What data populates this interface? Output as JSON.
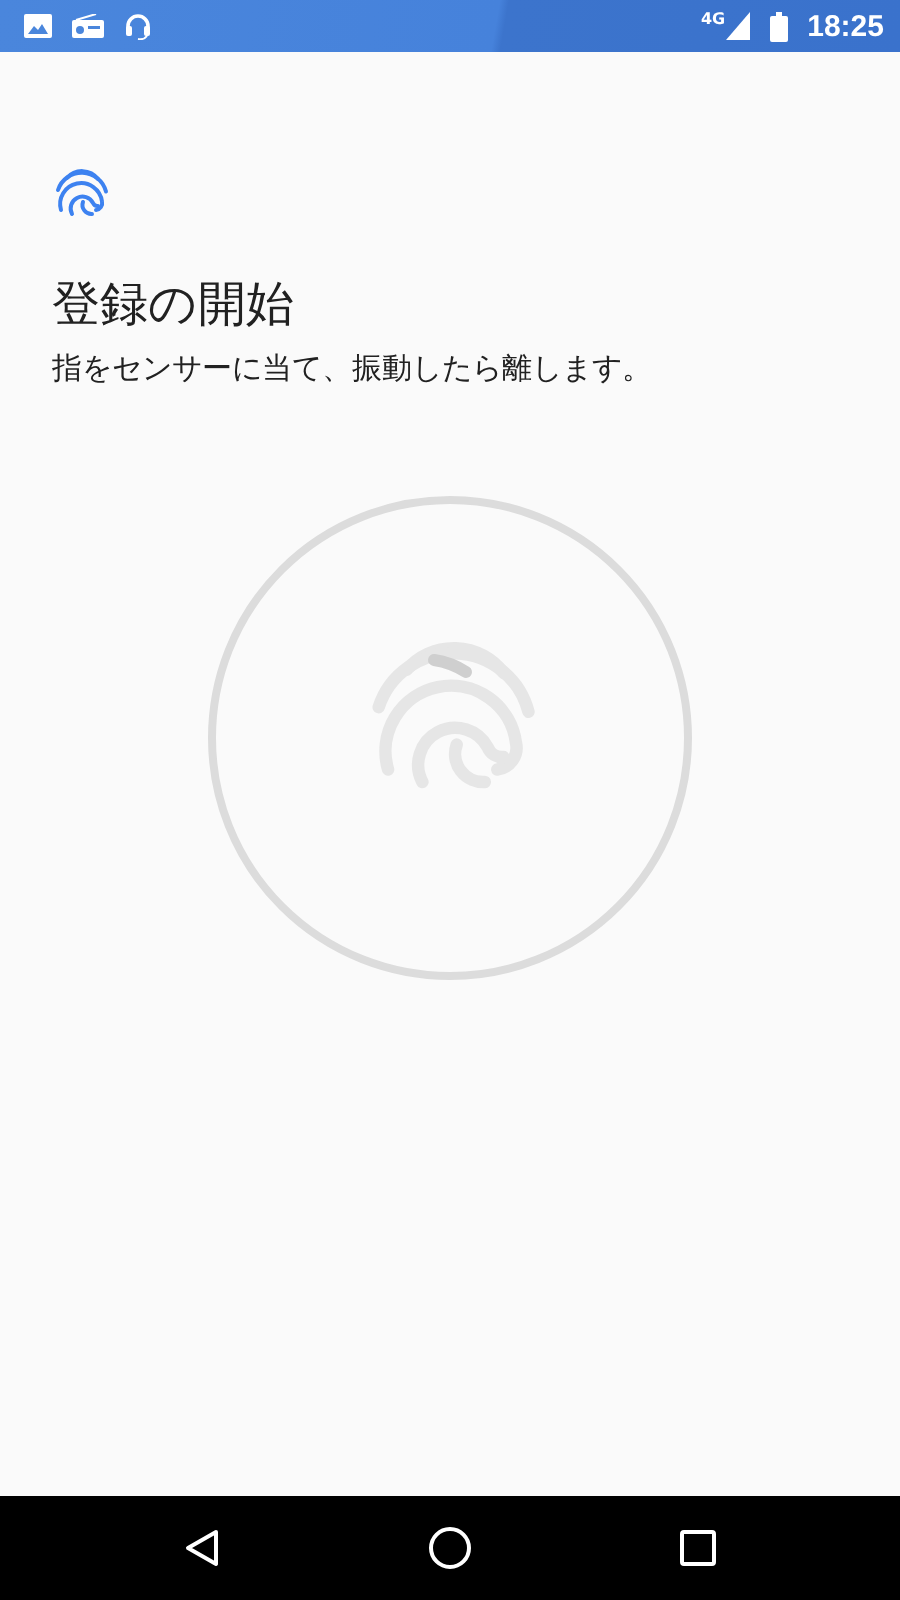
{
  "status_bar": {
    "network_type": "4G",
    "time": "18:25"
  },
  "header": {
    "title": "登録の開始",
    "instruction": "指をセンサーに当て、振動したら離します。"
  }
}
